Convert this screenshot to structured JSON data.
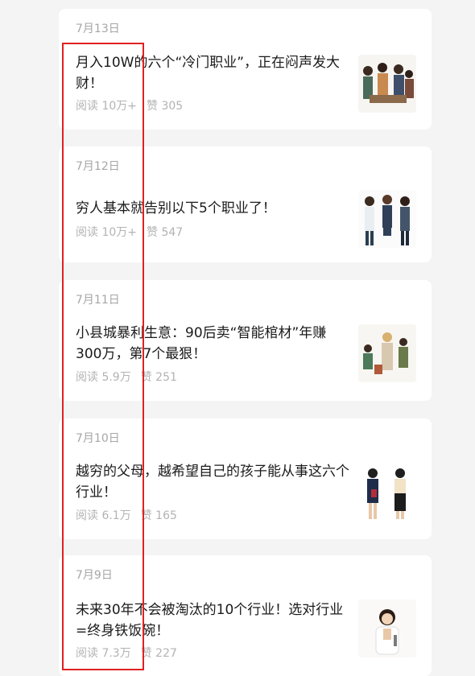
{
  "articles": [
    {
      "date": "7月13日",
      "title": "月入10W的六个“冷门职业”，正在闷声发大财！",
      "reads": "阅读 10万+",
      "likes": "赞 305",
      "thumb_icon": "people-working-illustration"
    },
    {
      "date": "7月12日",
      "title": "穷人基本就告别以下5个职业了！",
      "reads": "阅读 10万+",
      "likes": "赞 547",
      "thumb_icon": "professionals-illustration"
    },
    {
      "date": "7月11日",
      "title": "小县城暴利生意：90后卖“智能棺材”年赚300万，第7个最狠！",
      "reads": "阅读 5.9万",
      "likes": "赞 251",
      "thumb_icon": "workers-illustration"
    },
    {
      "date": "7月10日",
      "title": "越穷的父母，越希望自己的孩子能从事这六个行业！",
      "reads": "阅读 6.1万",
      "likes": "赞 165",
      "thumb_icon": "office-women-illustration"
    },
    {
      "date": "7月9日",
      "title": "未来30年不会被淘汰的10个行业！选对行业=终身铁饭碗！",
      "reads": "阅读 7.3万",
      "likes": "赞 227",
      "thumb_icon": "doctor-illustration"
    }
  ],
  "colors": {
    "highlight": "#e02020",
    "background": "#f4f4f4"
  }
}
